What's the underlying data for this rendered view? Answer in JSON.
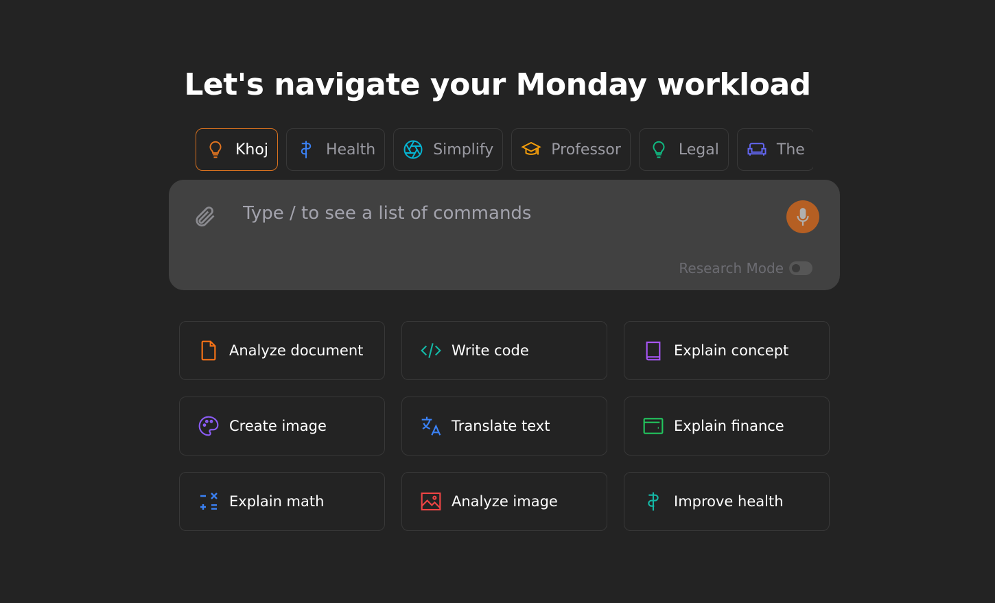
{
  "title": "Let's navigate your Monday workload",
  "tabs": [
    {
      "label": "Khoj",
      "icon": "lightbulb-icon",
      "color": "#e0731f",
      "active": true
    },
    {
      "label": "Health",
      "icon": "caduceus-icon",
      "color": "#3b82f6"
    },
    {
      "label": "Simplify",
      "icon": "aperture-icon",
      "color": "#06b6d4"
    },
    {
      "label": "Professor",
      "icon": "graduation-cap-icon",
      "color": "#f59e0b"
    },
    {
      "label": "Legal",
      "icon": "lightbulb-icon",
      "color": "#10b981"
    },
    {
      "label": "The",
      "icon": "couch-icon",
      "color": "#6366f1"
    }
  ],
  "input": {
    "placeholder": "Type / to see a list of commands",
    "research_mode_label": "Research Mode",
    "research_mode_on": false
  },
  "cards": [
    {
      "label": "Analyze document",
      "icon": "file-icon",
      "color": "#f97316"
    },
    {
      "label": "Write code",
      "icon": "code-icon",
      "color": "#14b8a6"
    },
    {
      "label": "Explain concept",
      "icon": "book-icon",
      "color": "#a855f7"
    },
    {
      "label": "Create image",
      "icon": "palette-icon",
      "color": "#8b5cf6"
    },
    {
      "label": "Translate text",
      "icon": "translate-icon",
      "color": "#3b82f6"
    },
    {
      "label": "Explain finance",
      "icon": "wallet-icon",
      "color": "#22c55e"
    },
    {
      "label": "Explain math",
      "icon": "math-operations-icon",
      "color": "#3b82f6"
    },
    {
      "label": "Analyze image",
      "icon": "image-icon",
      "color": "#ef4444"
    },
    {
      "label": "Improve health",
      "icon": "caduceus-icon",
      "color": "#14b8a6"
    }
  ]
}
